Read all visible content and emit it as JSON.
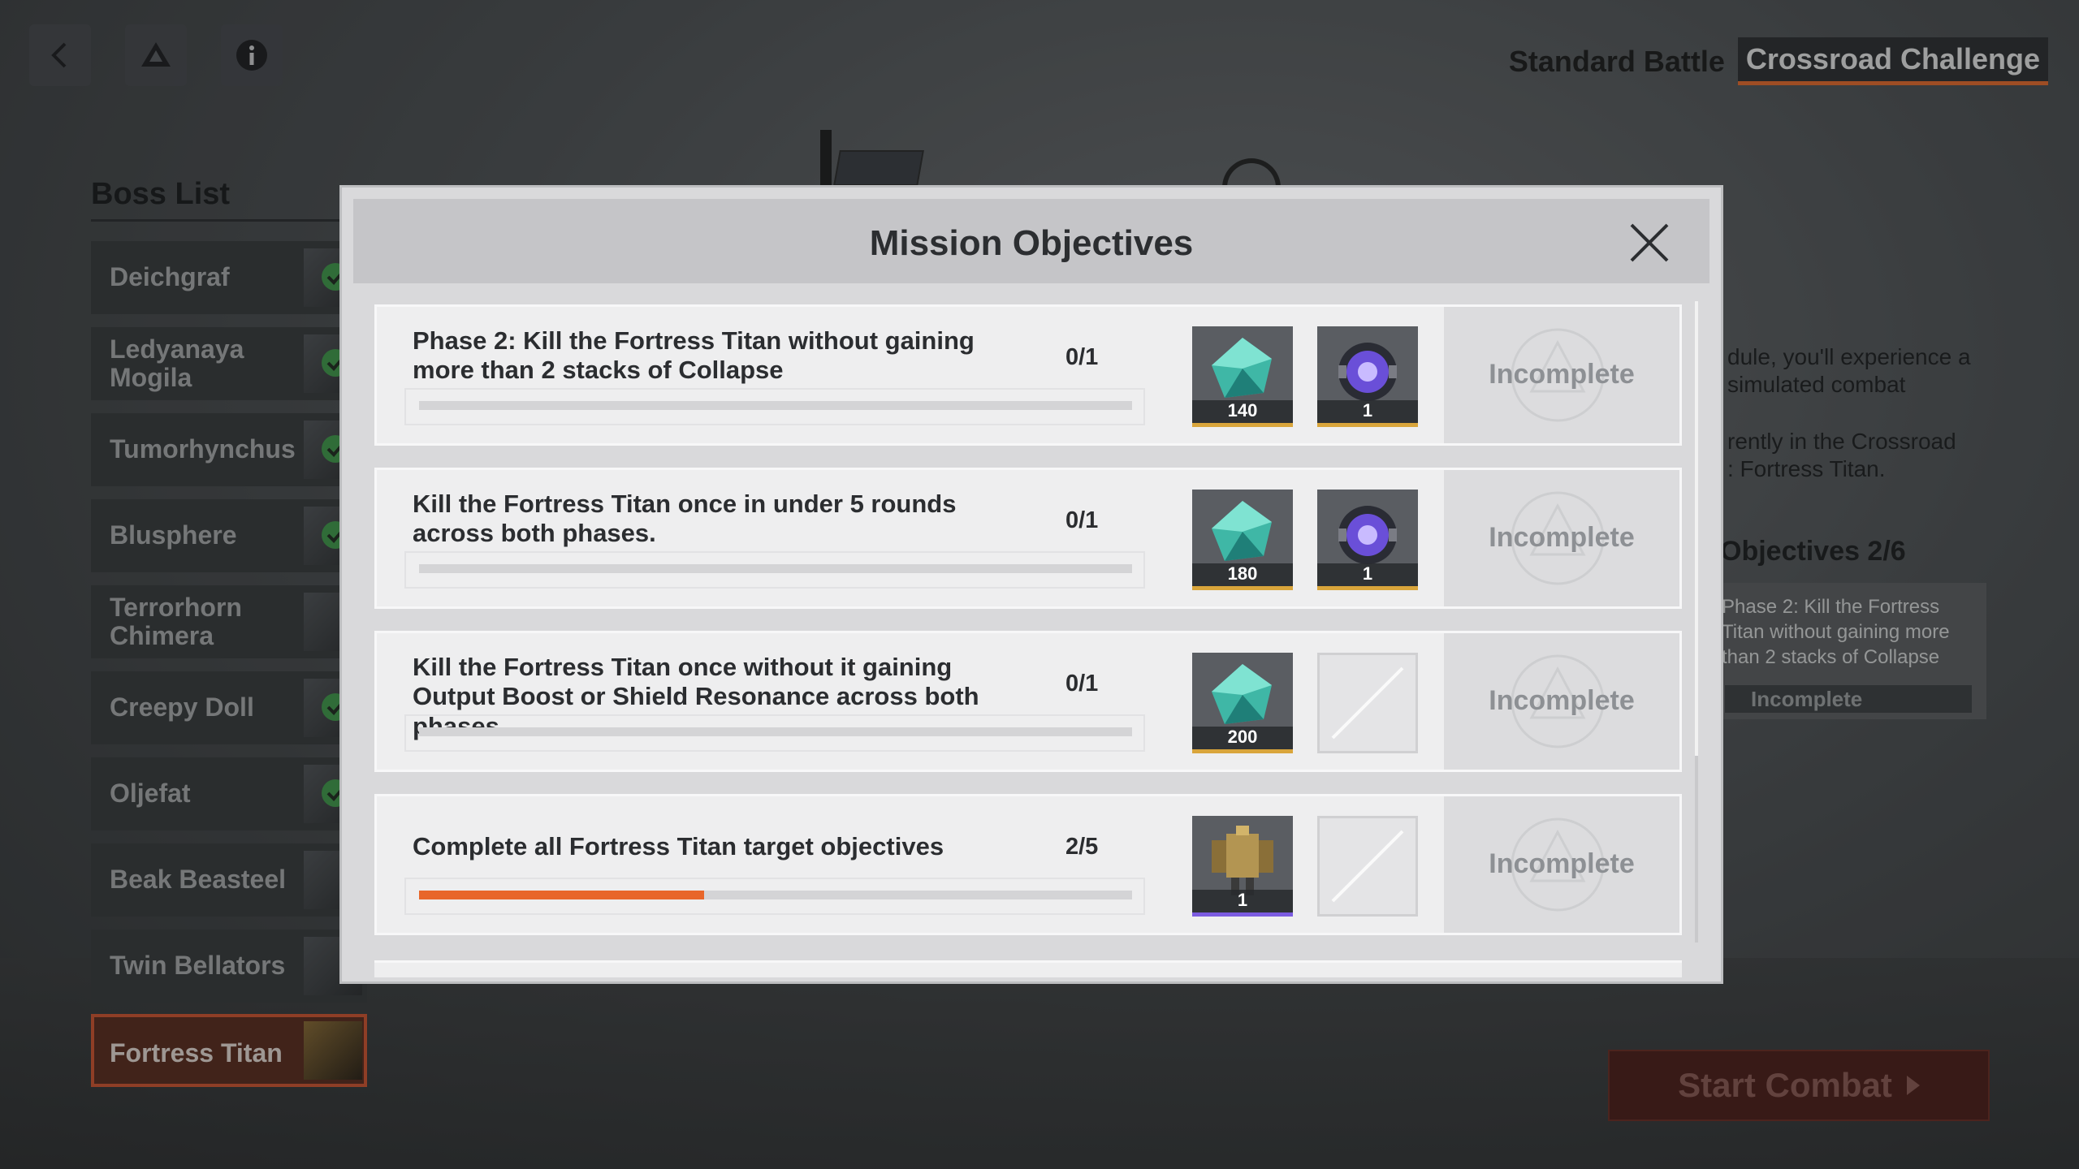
{
  "toolbar": {
    "back_icon": "back-arrow-icon",
    "map_icon": "triangle-logo-icon",
    "info_icon": "info-icon"
  },
  "mode_tabs": [
    {
      "label": "Standard Battle",
      "active": false
    },
    {
      "label": "Crossroad Challenge",
      "active": true
    }
  ],
  "boss_list": {
    "title": "Boss List",
    "items": [
      {
        "name": "Deichgraf",
        "cleared": true,
        "selected": false
      },
      {
        "name": "Ledyanaya Mogila",
        "cleared": true,
        "selected": false
      },
      {
        "name": "Tumorhynchus",
        "cleared": true,
        "selected": false
      },
      {
        "name": "Blusphere",
        "cleared": true,
        "selected": false
      },
      {
        "name": "Terrorhorn Chimera",
        "cleared": false,
        "selected": false
      },
      {
        "name": "Creepy Doll",
        "cleared": true,
        "selected": false
      },
      {
        "name": "Oljefat",
        "cleared": true,
        "selected": false
      },
      {
        "name": "Beak Beasteel",
        "cleared": false,
        "selected": false
      },
      {
        "name": "Twin Bellators",
        "cleared": false,
        "selected": false
      },
      {
        "name": "Fortress Titan",
        "cleared": false,
        "selected": true
      }
    ]
  },
  "info_panel": {
    "line1": "dule, you'll experience a",
    "line2": "simulated combat",
    "line3": "rently in the Crossroad",
    "line4": ": Fortress Titan.",
    "objectives_title": "Objectives 2/6",
    "objective_desc": "Phase 2: Kill the Fortress Titan without gaining more than 2 stacks of Collapse",
    "objective_status": "Incomplete"
  },
  "start_combat": {
    "label": "Start Combat"
  },
  "modal": {
    "title": "Mission Objectives",
    "close_icon": "close-icon",
    "objectives": [
      {
        "desc": "Phase 2: Kill the Fortress Titan without gaining more than 2 stacks of Collapse",
        "progress_text": "0/1",
        "progress": 0,
        "status": "Incomplete",
        "rewards": [
          {
            "icon": "crystal-icon",
            "qty": "140",
            "rarity": "gold"
          },
          {
            "icon": "purple-orb-icon",
            "qty": "1",
            "rarity": "gold"
          }
        ]
      },
      {
        "desc": "Kill the Fortress Titan once in under 5 rounds across both phases.",
        "progress_text": "0/1",
        "progress": 0,
        "status": "Incomplete",
        "rewards": [
          {
            "icon": "crystal-icon",
            "qty": "180",
            "rarity": "gold"
          },
          {
            "icon": "purple-orb-icon",
            "qty": "1",
            "rarity": "gold"
          }
        ]
      },
      {
        "desc": "Kill the Fortress Titan once without it gaining Output Boost or Shield Resonance across both phases.",
        "progress_text": "0/1",
        "progress": 0,
        "status": "Incomplete",
        "rewards": [
          {
            "icon": "crystal-icon",
            "qty": "200",
            "rarity": "gold"
          },
          {
            "icon": "empty-slot-icon",
            "qty": "",
            "rarity": "none"
          }
        ]
      },
      {
        "desc": "Complete all Fortress Titan target objectives",
        "progress_text": "2/5",
        "progress": 0.4,
        "status": "Incomplete",
        "rewards": [
          {
            "icon": "armor-mech-icon",
            "qty": "1",
            "rarity": "purple"
          },
          {
            "icon": "empty-slot-icon",
            "qty": "",
            "rarity": "none"
          }
        ]
      }
    ]
  },
  "colors": {
    "accent_orange": "#e8662a",
    "selected_boss_border": "#d2542e",
    "cleared_check": "#3f9a4a"
  }
}
